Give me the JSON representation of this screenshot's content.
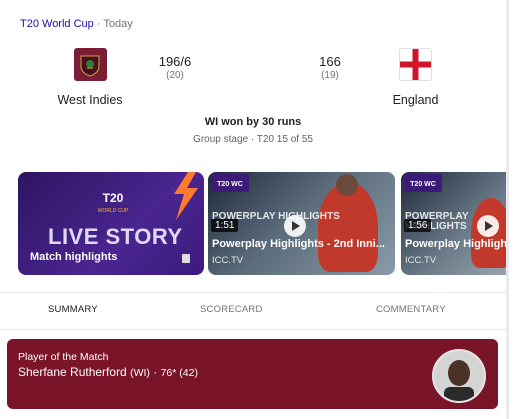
{
  "header": {
    "tournament": "T20 World Cup",
    "separator": "·",
    "day": "Today"
  },
  "teams": [
    {
      "name": "West Indies",
      "runs": "196/6",
      "overs": "(20)",
      "flag_color": "#7b1e35"
    },
    {
      "name": "England",
      "runs": "166",
      "overs": "(19)",
      "flag_color": "#cf142b"
    }
  ],
  "result": "WI won by 30 runs",
  "stage": "Group stage · T20 15 of 55",
  "cards": [
    {
      "title": "Match highlights",
      "overlay_text": "LIVE STORY",
      "icon": "story-icon"
    },
    {
      "title": "Powerplay Highlights - 2nd Inni...",
      "duration": "1:51",
      "source": "ICC.TV",
      "overlay_text": "POWERPLAY HIGHLIGHTS"
    },
    {
      "title": "Powerplay Highligh",
      "duration": "1:56",
      "source": "ICC.TV",
      "overlay_text": "POWERPLAY HIGHLIGHTS"
    }
  ],
  "tabs": [
    {
      "label": "SUMMARY",
      "active": true
    },
    {
      "label": "SCORECARD",
      "active": false
    },
    {
      "label": "COMMENTARY",
      "active": false
    }
  ],
  "potm": {
    "label": "Player of the Match",
    "name": "Sherfane Rutherford",
    "team_code": "(WI)",
    "separator": "·",
    "stats": "76* (42)"
  },
  "colors": {
    "accent": "#1a0dab",
    "potm_bg": "#7a1428",
    "card_purple": "#3b1a78"
  }
}
